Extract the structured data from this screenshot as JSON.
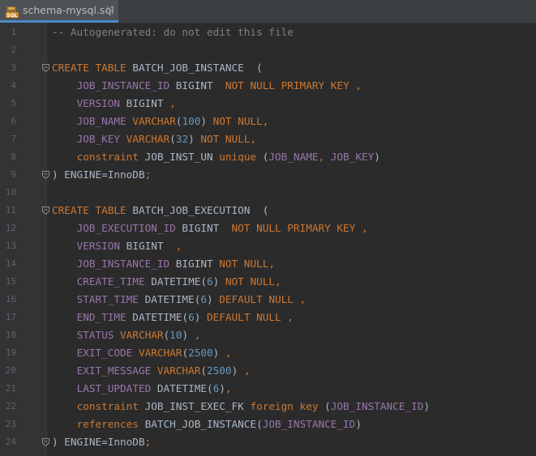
{
  "tab": {
    "filename": "schema-mysql.sql",
    "close_glyph": "×",
    "icon_text": "SQL"
  },
  "colors": {
    "keyword": "#cc7832",
    "column": "#9876aa",
    "number": "#6897bb",
    "comment": "#808080",
    "text": "#a9b7c6"
  },
  "lines": [
    {
      "n": "1",
      "tokens": [
        [
          "cmt",
          "-- Autogenerated: do not edit this file"
        ]
      ]
    },
    {
      "n": "2",
      "tokens": []
    },
    {
      "n": "3",
      "fold": true,
      "tokens": [
        [
          "kw",
          "CREATE TABLE "
        ],
        [
          "plain",
          "BATCH_JOB_INSTANCE  ("
        ]
      ]
    },
    {
      "n": "4",
      "tokens": [
        [
          "plain",
          "    "
        ],
        [
          "col",
          "JOB_INSTANCE_ID"
        ],
        [
          "plain",
          " BIGINT  "
        ],
        [
          "kw",
          "NOT NULL PRIMARY KEY ,"
        ]
      ]
    },
    {
      "n": "5",
      "tokens": [
        [
          "plain",
          "    "
        ],
        [
          "col",
          "VERSION"
        ],
        [
          "plain",
          " BIGINT "
        ],
        [
          "kw",
          ","
        ]
      ]
    },
    {
      "n": "6",
      "tokens": [
        [
          "plain",
          "    "
        ],
        [
          "col",
          "JOB_NAME"
        ],
        [
          "plain",
          " "
        ],
        [
          "kw",
          "VARCHAR"
        ],
        [
          "plain",
          "("
        ],
        [
          "num",
          "100"
        ],
        [
          "plain",
          ") "
        ],
        [
          "kw",
          "NOT NULL,"
        ]
      ]
    },
    {
      "n": "7",
      "tokens": [
        [
          "plain",
          "    "
        ],
        [
          "col",
          "JOB_KEY"
        ],
        [
          "plain",
          " "
        ],
        [
          "kw",
          "VARCHAR"
        ],
        [
          "plain",
          "("
        ],
        [
          "num",
          "32"
        ],
        [
          "plain",
          ") "
        ],
        [
          "kw",
          "NOT NULL,"
        ]
      ]
    },
    {
      "n": "8",
      "tokens": [
        [
          "plain",
          "    "
        ],
        [
          "kw",
          "constraint"
        ],
        [
          "plain",
          " JOB_INST_UN "
        ],
        [
          "kw",
          "unique"
        ],
        [
          "plain",
          " ("
        ],
        [
          "col",
          "JOB_NAME"
        ],
        [
          "kw",
          ", "
        ],
        [
          "col",
          "JOB_KEY"
        ],
        [
          "plain",
          ")"
        ]
      ]
    },
    {
      "n": "9",
      "fold": true,
      "tokens": [
        [
          "plain",
          ") ENGINE=InnoDB"
        ],
        [
          "kw",
          ";"
        ]
      ]
    },
    {
      "n": "10",
      "tokens": []
    },
    {
      "n": "11",
      "fold": true,
      "tokens": [
        [
          "kw",
          "CREATE TABLE "
        ],
        [
          "plain",
          "BATCH_JOB_EXECUTION  ("
        ]
      ]
    },
    {
      "n": "12",
      "tokens": [
        [
          "plain",
          "    "
        ],
        [
          "col",
          "JOB_EXECUTION_ID"
        ],
        [
          "plain",
          " BIGINT  "
        ],
        [
          "kw",
          "NOT NULL PRIMARY KEY ,"
        ]
      ]
    },
    {
      "n": "13",
      "tokens": [
        [
          "plain",
          "    "
        ],
        [
          "col",
          "VERSION"
        ],
        [
          "plain",
          " BIGINT  "
        ],
        [
          "kw",
          ","
        ]
      ]
    },
    {
      "n": "14",
      "tokens": [
        [
          "plain",
          "    "
        ],
        [
          "col",
          "JOB_INSTANCE_ID"
        ],
        [
          "plain",
          " BIGINT "
        ],
        [
          "kw",
          "NOT NULL,"
        ]
      ]
    },
    {
      "n": "15",
      "tokens": [
        [
          "plain",
          "    "
        ],
        [
          "col",
          "CREATE_TIME"
        ],
        [
          "plain",
          " DATETIME("
        ],
        [
          "num",
          "6"
        ],
        [
          "plain",
          ") "
        ],
        [
          "kw",
          "NOT NULL,"
        ]
      ]
    },
    {
      "n": "16",
      "tokens": [
        [
          "plain",
          "    "
        ],
        [
          "col",
          "START_TIME"
        ],
        [
          "plain",
          " DATETIME("
        ],
        [
          "num",
          "6"
        ],
        [
          "plain",
          ") "
        ],
        [
          "kw",
          "DEFAULT NULL ,"
        ]
      ]
    },
    {
      "n": "17",
      "tokens": [
        [
          "plain",
          "    "
        ],
        [
          "col",
          "END_TIME"
        ],
        [
          "plain",
          " DATETIME("
        ],
        [
          "num",
          "6"
        ],
        [
          "plain",
          ") "
        ],
        [
          "kw",
          "DEFAULT NULL ,"
        ]
      ]
    },
    {
      "n": "18",
      "tokens": [
        [
          "plain",
          "    "
        ],
        [
          "col",
          "STATUS"
        ],
        [
          "plain",
          " "
        ],
        [
          "kw",
          "VARCHAR"
        ],
        [
          "plain",
          "("
        ],
        [
          "num",
          "10"
        ],
        [
          "plain",
          ") "
        ],
        [
          "kw",
          ","
        ]
      ]
    },
    {
      "n": "19",
      "tokens": [
        [
          "plain",
          "    "
        ],
        [
          "col",
          "EXIT_CODE"
        ],
        [
          "plain",
          " "
        ],
        [
          "kw",
          "VARCHAR"
        ],
        [
          "plain",
          "("
        ],
        [
          "num",
          "2500"
        ],
        [
          "plain",
          ") "
        ],
        [
          "kw",
          ","
        ]
      ]
    },
    {
      "n": "20",
      "tokens": [
        [
          "plain",
          "    "
        ],
        [
          "col",
          "EXIT_MESSAGE"
        ],
        [
          "plain",
          " "
        ],
        [
          "kw",
          "VARCHAR"
        ],
        [
          "plain",
          "("
        ],
        [
          "num",
          "2500"
        ],
        [
          "plain",
          ") "
        ],
        [
          "kw",
          ","
        ]
      ]
    },
    {
      "n": "21",
      "tokens": [
        [
          "plain",
          "    "
        ],
        [
          "col",
          "LAST_UPDATED"
        ],
        [
          "plain",
          " DATETIME("
        ],
        [
          "num",
          "6"
        ],
        [
          "plain",
          ")"
        ],
        [
          "kw",
          ","
        ]
      ]
    },
    {
      "n": "22",
      "tokens": [
        [
          "plain",
          "    "
        ],
        [
          "kw",
          "constraint"
        ],
        [
          "plain",
          " JOB_INST_EXEC_FK "
        ],
        [
          "kw",
          "foreign key"
        ],
        [
          "plain",
          " ("
        ],
        [
          "col",
          "JOB_INSTANCE_ID"
        ],
        [
          "plain",
          ")"
        ]
      ]
    },
    {
      "n": "23",
      "tokens": [
        [
          "plain",
          "    "
        ],
        [
          "kw",
          "references"
        ],
        [
          "plain",
          " BATCH_JOB_INSTANCE("
        ],
        [
          "col",
          "JOB_INSTANCE_ID"
        ],
        [
          "plain",
          ")"
        ]
      ]
    },
    {
      "n": "24",
      "fold": true,
      "tokens": [
        [
          "plain",
          ") ENGINE=InnoDB"
        ],
        [
          "kw",
          ";"
        ]
      ]
    }
  ]
}
